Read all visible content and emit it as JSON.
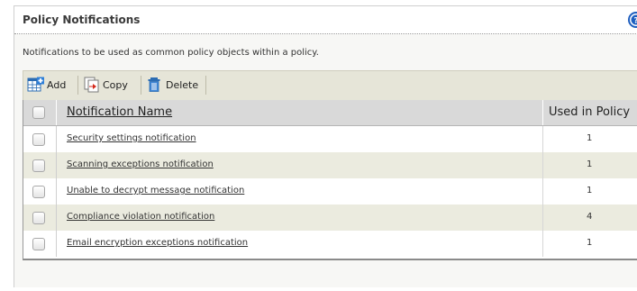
{
  "panel": {
    "title": "Policy Notifications",
    "help_icon": "help-icon",
    "description": "Notifications to be used as common policy objects within a policy."
  },
  "toolbar": {
    "add_label": "Add",
    "copy_label": "Copy",
    "delete_label": "Delete",
    "add_icon": "add-icon",
    "copy_icon": "copy-icon",
    "delete_icon": "trash-icon"
  },
  "table": {
    "columns": [
      "Notification Name",
      "Used in Policy"
    ],
    "rows": [
      {
        "name": "Security settings notification",
        "used": "1"
      },
      {
        "name": "Scanning exceptions notification",
        "used": "1"
      },
      {
        "name": "Unable to decrypt message notification",
        "used": "1"
      },
      {
        "name": "Compliance violation notification",
        "used": "4"
      },
      {
        "name": "Email encryption exceptions notification",
        "used": "1"
      }
    ]
  },
  "colors": {
    "toolbar_bg": "#e6e5d8",
    "header_bg": "#d9d9d9",
    "alt_row_bg": "#ebebdf",
    "help_icon": "#1f5fbf"
  }
}
